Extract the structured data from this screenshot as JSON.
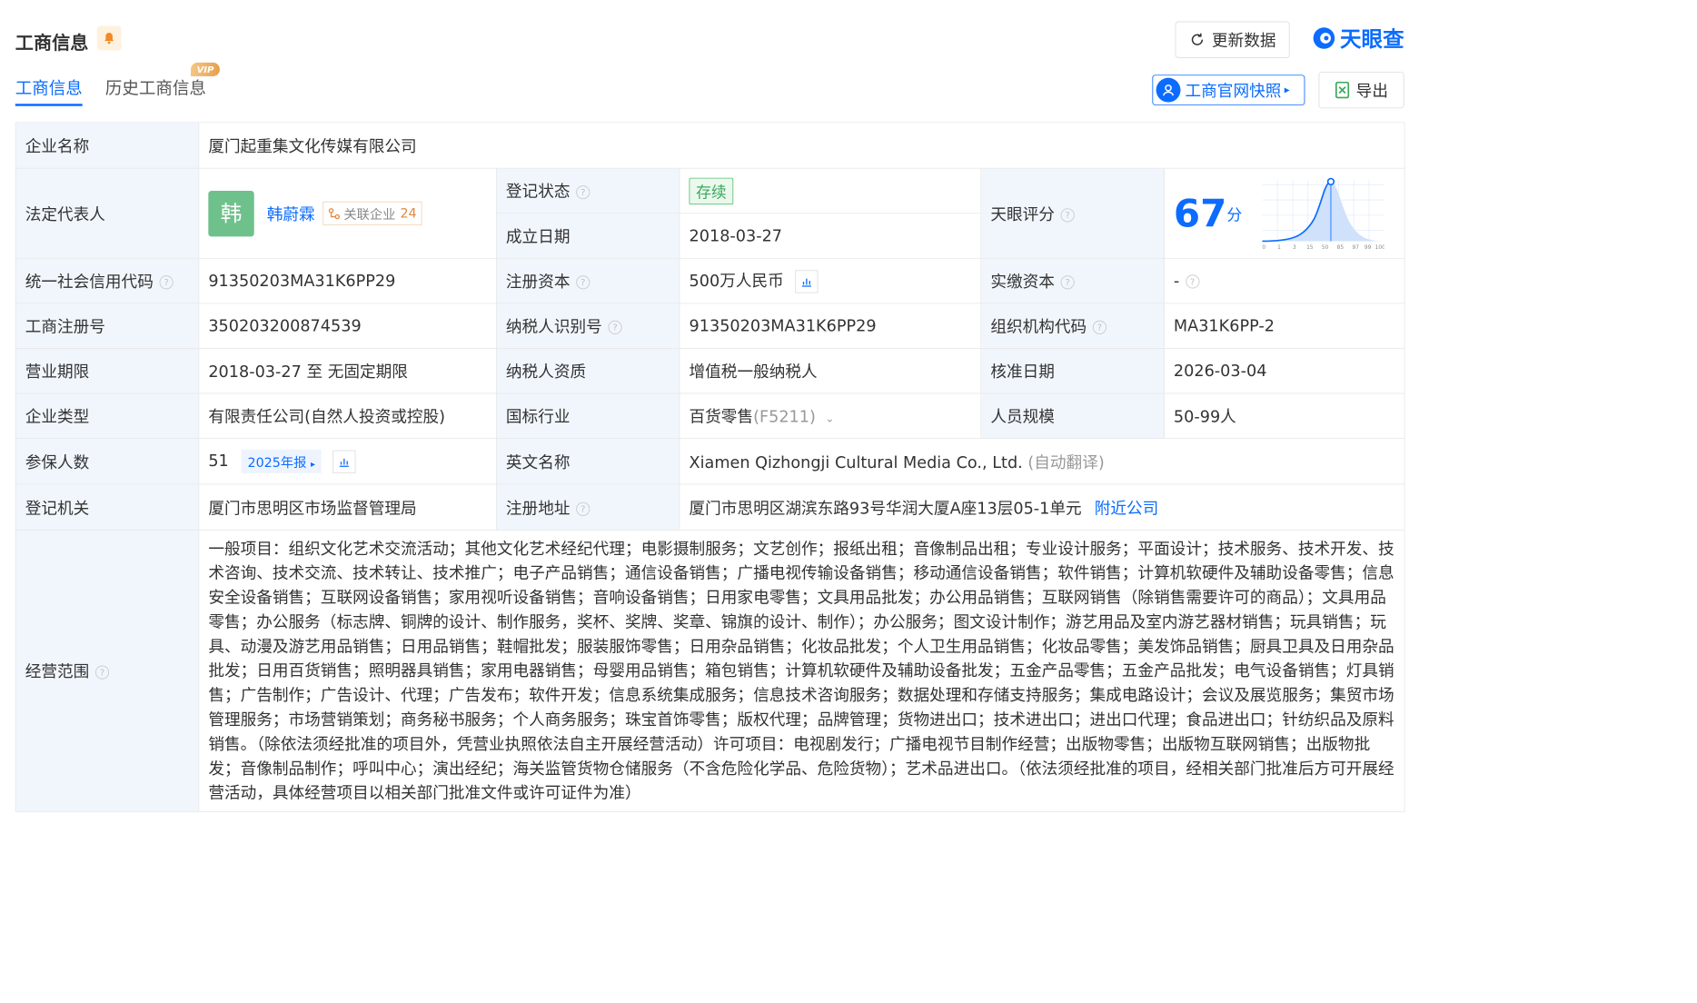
{
  "header": {
    "title": "工商信息",
    "refresh_label": "更新数据",
    "brand": "天眼查"
  },
  "tabs": [
    {
      "label": "工商信息",
      "active": true
    },
    {
      "label": "历史工商信息",
      "badge": "VIP"
    }
  ],
  "actions": {
    "official_snapshot": "工商官网快照",
    "export": "导出"
  },
  "info": {
    "company_name_label": "企业名称",
    "company_name": "厦门起重集文化传媒有限公司",
    "legal_rep_label": "法定代表人",
    "legal_rep_avatar": "韩",
    "legal_rep_name": "韩蔚霖",
    "related_label": "关联企业",
    "related_count": "24",
    "reg_status_label": "登记状态",
    "reg_status": "存续",
    "found_date_label": "成立日期",
    "found_date": "2018-03-27",
    "tianyan_score_label": "天眼评分",
    "tianyan_score": "67",
    "score_unit": "分",
    "score_axis": [
      "0",
      "1",
      "3",
      "15",
      "50",
      "85",
      "97",
      "99",
      "100"
    ],
    "credit_code_label": "统一社会信用代码",
    "credit_code": "91350203MA31K6PP29",
    "reg_capital_label": "注册资本",
    "reg_capital": "500万人民币",
    "paid_capital_label": "实缴资本",
    "paid_capital": "-",
    "biz_reg_no_label": "工商注册号",
    "biz_reg_no": "350203200874539",
    "taxpayer_id_label": "纳税人识别号",
    "taxpayer_id": "91350203MA31K6PP29",
    "org_code_label": "组织机构代码",
    "org_code": "MA31K6PP-2",
    "biz_term_label": "营业期限",
    "biz_term": "2018-03-27 至 无固定期限",
    "taxpayer_qual_label": "纳税人资质",
    "taxpayer_qual": "增值税一般纳税人",
    "approval_date_label": "核准日期",
    "approval_date": "2026-03-04",
    "company_type_label": "企业类型",
    "company_type": "有限责任公司(自然人投资或控股)",
    "industry_label": "国标行业",
    "industry": "百货零售",
    "industry_code": "(F5211)",
    "staff_size_label": "人员规模",
    "staff_size": "50-99人",
    "insured_label": "参保人数",
    "insured": "51",
    "insured_year": "2025年报",
    "english_name_label": "英文名称",
    "english_name": "Xiamen Qizhongji Cultural Media Co., Ltd.",
    "auto_translate": "(自动翻译)",
    "reg_authority_label": "登记机关",
    "reg_authority": "厦门市思明区市场监督管理局",
    "reg_address_label": "注册地址",
    "reg_address": "厦门市思明区湖滨东路93号华润大厦A座13层05-1单元",
    "nearby_link": "附近公司",
    "scope_label": "经营范围",
    "scope": "一般项目：组织文化艺术交流活动；其他文化艺术经纪代理；电影摄制服务；文艺创作；报纸出租；音像制品出租；专业设计服务；平面设计；技术服务、技术开发、技术咨询、技术交流、技术转让、技术推广；电子产品销售；通信设备销售；广播电视传输设备销售；移动通信设备销售；软件销售；计算机软硬件及辅助设备零售；信息安全设备销售；互联网设备销售；家用视听设备销售；音响设备销售；日用家电零售；文具用品批发；办公用品销售；互联网销售（除销售需要许可的商品）；文具用品零售；办公服务（标志牌、铜牌的设计、制作服务，奖杯、奖牌、奖章、锦旗的设计、制作）；办公服务；图文设计制作；游艺用品及室内游艺器材销售；玩具销售；玩具、动漫及游艺用品销售；日用品销售；鞋帽批发；服装服饰零售；日用杂品销售；化妆品批发；个人卫生用品销售；化妆品零售；美发饰品销售；厨具卫具及日用杂品批发；日用百货销售；照明器具销售；家用电器销售；母婴用品销售；箱包销售；计算机软硬件及辅助设备批发；五金产品零售；五金产品批发；电气设备销售；灯具销售；广告制作；广告设计、代理；广告发布；软件开发；信息系统集成服务；信息技术咨询服务；数据处理和存储支持服务；集成电路设计；会议及展览服务；集贸市场管理服务；市场营销策划；商务秘书服务；个人商务服务；珠宝首饰零售；版权代理；品牌管理；货物进出口；技术进出口；进出口代理；食品进出口；针纺织品及原料销售。（除依法须经批准的项目外，凭营业执照依法自主开展经营活动）许可项目：电视剧发行；广播电视节目制作经营；出版物零售；出版物互联网销售；出版物批发；音像制品制作；呼叫中心；演出经纪；海关监管货物仓储服务（不含危险化学品、危险货物）；艺术品进出口。（依法须经批准的项目，经相关部门批准后方可开展经营活动，具体经营项目以相关部门批准文件或许可证件为准）"
  },
  "colors": {
    "accent": "#0b6cff",
    "label_bg": "#f1f6fd",
    "status_green": "#3aa85a",
    "avatar_green": "#6fc18b"
  }
}
